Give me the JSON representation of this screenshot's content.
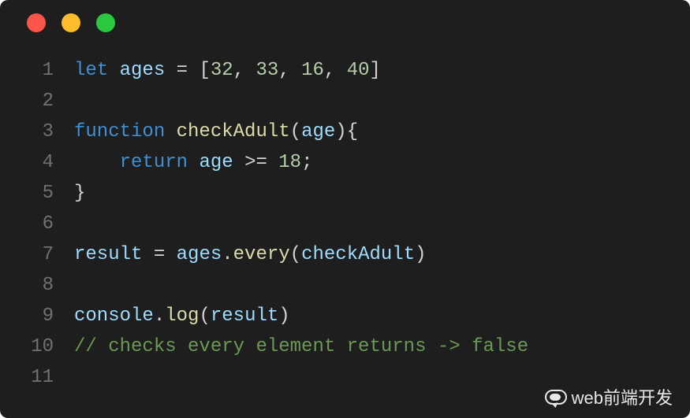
{
  "window": {
    "traffic_lights": [
      "close",
      "minimize",
      "zoom"
    ]
  },
  "code": {
    "lines": [
      {
        "num": "1",
        "tokens": [
          [
            "kw",
            "let"
          ],
          [
            "plain",
            " "
          ],
          [
            "var",
            "ages"
          ],
          [
            "plain",
            " "
          ],
          [
            "op",
            "="
          ],
          [
            "plain",
            " "
          ],
          [
            "op",
            "["
          ],
          [
            "num",
            "32"
          ],
          [
            "op",
            ","
          ],
          [
            "plain",
            " "
          ],
          [
            "num",
            "33"
          ],
          [
            "op",
            ","
          ],
          [
            "plain",
            " "
          ],
          [
            "num",
            "16"
          ],
          [
            "op",
            ","
          ],
          [
            "plain",
            " "
          ],
          [
            "num",
            "40"
          ],
          [
            "op",
            "]"
          ]
        ]
      },
      {
        "num": "2",
        "tokens": []
      },
      {
        "num": "3",
        "tokens": [
          [
            "kw",
            "function"
          ],
          [
            "plain",
            " "
          ],
          [
            "fn",
            "checkAdult"
          ],
          [
            "paren",
            "("
          ],
          [
            "var",
            "age"
          ],
          [
            "paren",
            ")"
          ],
          [
            "paren",
            "{"
          ]
        ]
      },
      {
        "num": "4",
        "tokens": [
          [
            "plain",
            "    "
          ],
          [
            "kw",
            "return"
          ],
          [
            "plain",
            " "
          ],
          [
            "var",
            "age"
          ],
          [
            "plain",
            " "
          ],
          [
            "op",
            ">="
          ],
          [
            "plain",
            " "
          ],
          [
            "num",
            "18"
          ],
          [
            "op",
            ";"
          ]
        ]
      },
      {
        "num": "5",
        "tokens": [
          [
            "paren",
            "}"
          ]
        ]
      },
      {
        "num": "6",
        "tokens": []
      },
      {
        "num": "7",
        "tokens": [
          [
            "var",
            "result"
          ],
          [
            "plain",
            " "
          ],
          [
            "op",
            "="
          ],
          [
            "plain",
            " "
          ],
          [
            "obj",
            "ages"
          ],
          [
            "op",
            "."
          ],
          [
            "fn",
            "every"
          ],
          [
            "paren",
            "("
          ],
          [
            "var",
            "checkAdult"
          ],
          [
            "paren",
            ")"
          ]
        ]
      },
      {
        "num": "8",
        "tokens": []
      },
      {
        "num": "9",
        "tokens": [
          [
            "obj",
            "console"
          ],
          [
            "op",
            "."
          ],
          [
            "fn",
            "log"
          ],
          [
            "paren",
            "("
          ],
          [
            "var",
            "result"
          ],
          [
            "paren",
            ")"
          ]
        ]
      },
      {
        "num": "10",
        "tokens": [
          [
            "cmt",
            "// checks every element returns -> false"
          ]
        ]
      },
      {
        "num": "11",
        "tokens": []
      }
    ]
  },
  "watermark": {
    "label": "web前端开发"
  }
}
